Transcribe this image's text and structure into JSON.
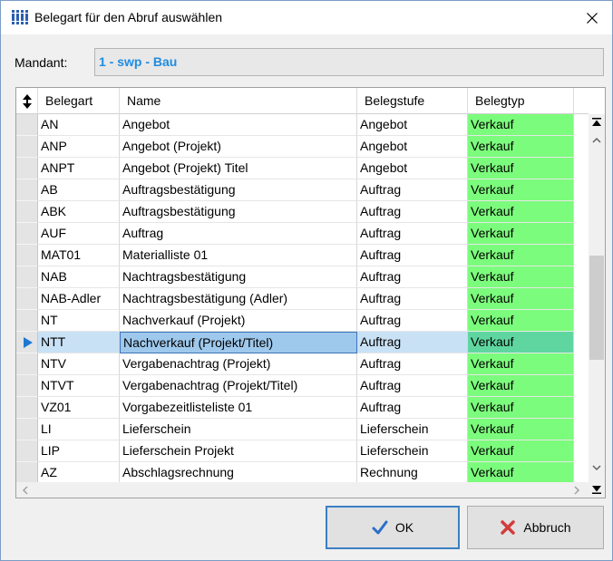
{
  "window": {
    "title": "Belegart für den Abruf auswählen",
    "close_glyph": "✕"
  },
  "mandant": {
    "label": "Mandant:",
    "value": "1 - swp - Bau"
  },
  "grid": {
    "columns": [
      "Belegart",
      "Name",
      "Belegstufe",
      "Belegtyp"
    ],
    "rows": [
      {
        "belegart": "AN",
        "name": "Angebot",
        "belegstufe": "Angebot",
        "belegtyp": "Verkauf"
      },
      {
        "belegart": "ANP",
        "name": "Angebot (Projekt)",
        "belegstufe": "Angebot",
        "belegtyp": "Verkauf"
      },
      {
        "belegart": "ANPT",
        "name": "Angebot (Projekt) Titel",
        "belegstufe": "Angebot",
        "belegtyp": "Verkauf"
      },
      {
        "belegart": "AB",
        "name": "Auftragsbestätigung",
        "belegstufe": "Auftrag",
        "belegtyp": "Verkauf"
      },
      {
        "belegart": "ABK",
        "name": "Auftragsbestätigung",
        "belegstufe": "Auftrag",
        "belegtyp": "Verkauf"
      },
      {
        "belegart": "AUF",
        "name": "Auftrag",
        "belegstufe": "Auftrag",
        "belegtyp": "Verkauf"
      },
      {
        "belegart": "MAT01",
        "name": "Materialliste 01",
        "belegstufe": "Auftrag",
        "belegtyp": "Verkauf"
      },
      {
        "belegart": "NAB",
        "name": "Nachtragsbestätigung",
        "belegstufe": "Auftrag",
        "belegtyp": "Verkauf"
      },
      {
        "belegart": "NAB-Adler",
        "name": "Nachtragsbestätigung (Adler)",
        "belegstufe": "Auftrag",
        "belegtyp": "Verkauf"
      },
      {
        "belegart": "NT",
        "name": "Nachverkauf (Projekt)",
        "belegstufe": "Auftrag",
        "belegtyp": "Verkauf"
      },
      {
        "belegart": "NTT",
        "name": "Nachverkauf (Projekt/Titel)",
        "belegstufe": "Auftrag",
        "belegtyp": "Verkauf",
        "selected": true
      },
      {
        "belegart": "NTV",
        "name": "Vergabenachtrag (Projekt)",
        "belegstufe": "Auftrag",
        "belegtyp": "Verkauf"
      },
      {
        "belegart": "NTVT",
        "name": "Vergabenachtrag (Projekt/Titel)",
        "belegstufe": "Auftrag",
        "belegtyp": "Verkauf"
      },
      {
        "belegart": "VZ01",
        "name": "Vorgabezeitlisteliste 01",
        "belegstufe": "Auftrag",
        "belegtyp": "Verkauf"
      },
      {
        "belegart": "LI",
        "name": "Lieferschein",
        "belegstufe": "Lieferschein",
        "belegtyp": "Verkauf"
      },
      {
        "belegart": "LIP",
        "name": "Lieferschein Projekt",
        "belegstufe": "Lieferschein",
        "belegtyp": "Verkauf"
      },
      {
        "belegart": "AZ",
        "name": "Abschlagsrechnung",
        "belegstufe": "Rechnung",
        "belegtyp": "Verkauf"
      }
    ]
  },
  "buttons": {
    "ok_label": "OK",
    "cancel_label": "Abbruch"
  },
  "colors": {
    "mandant_text": "#1e8ce0",
    "belegtyp_bg": "#7cfc7c",
    "selected_row": "#c9e1f5",
    "row_pointer": "#1e78d2",
    "ok_check": "#2a6fc9",
    "cancel_x": "#d23c3c"
  }
}
